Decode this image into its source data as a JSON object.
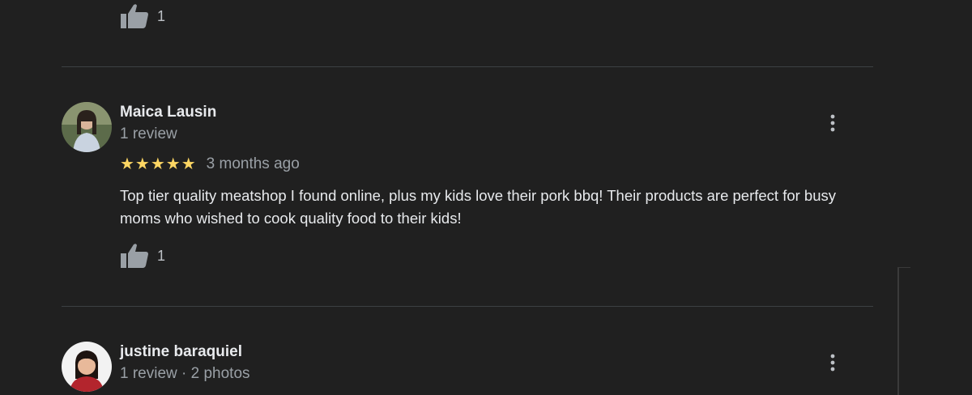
{
  "top_partial": {
    "like_count": "1"
  },
  "reviews": [
    {
      "name": "Maica Lausin",
      "meta": "1 review",
      "stars": "★★★★★",
      "rating": 5,
      "date": "3 months ago",
      "text": "Top tier quality meatshop I found online, plus my kids love their pork bbq! Their products are perfect for busy moms who wished to cook quality food to their kids!",
      "like_count": "1"
    },
    {
      "name": "justine baraquiel",
      "meta": "1 review · 2 photos"
    }
  ],
  "colors": {
    "background": "#202020",
    "divider": "#3c4043",
    "star": "#fdd663",
    "text_primary": "#e8eaed",
    "text_secondary": "#9aa0a6"
  },
  "icons": {
    "like": "thumbs-up-icon",
    "more": "more-vert-icon"
  }
}
